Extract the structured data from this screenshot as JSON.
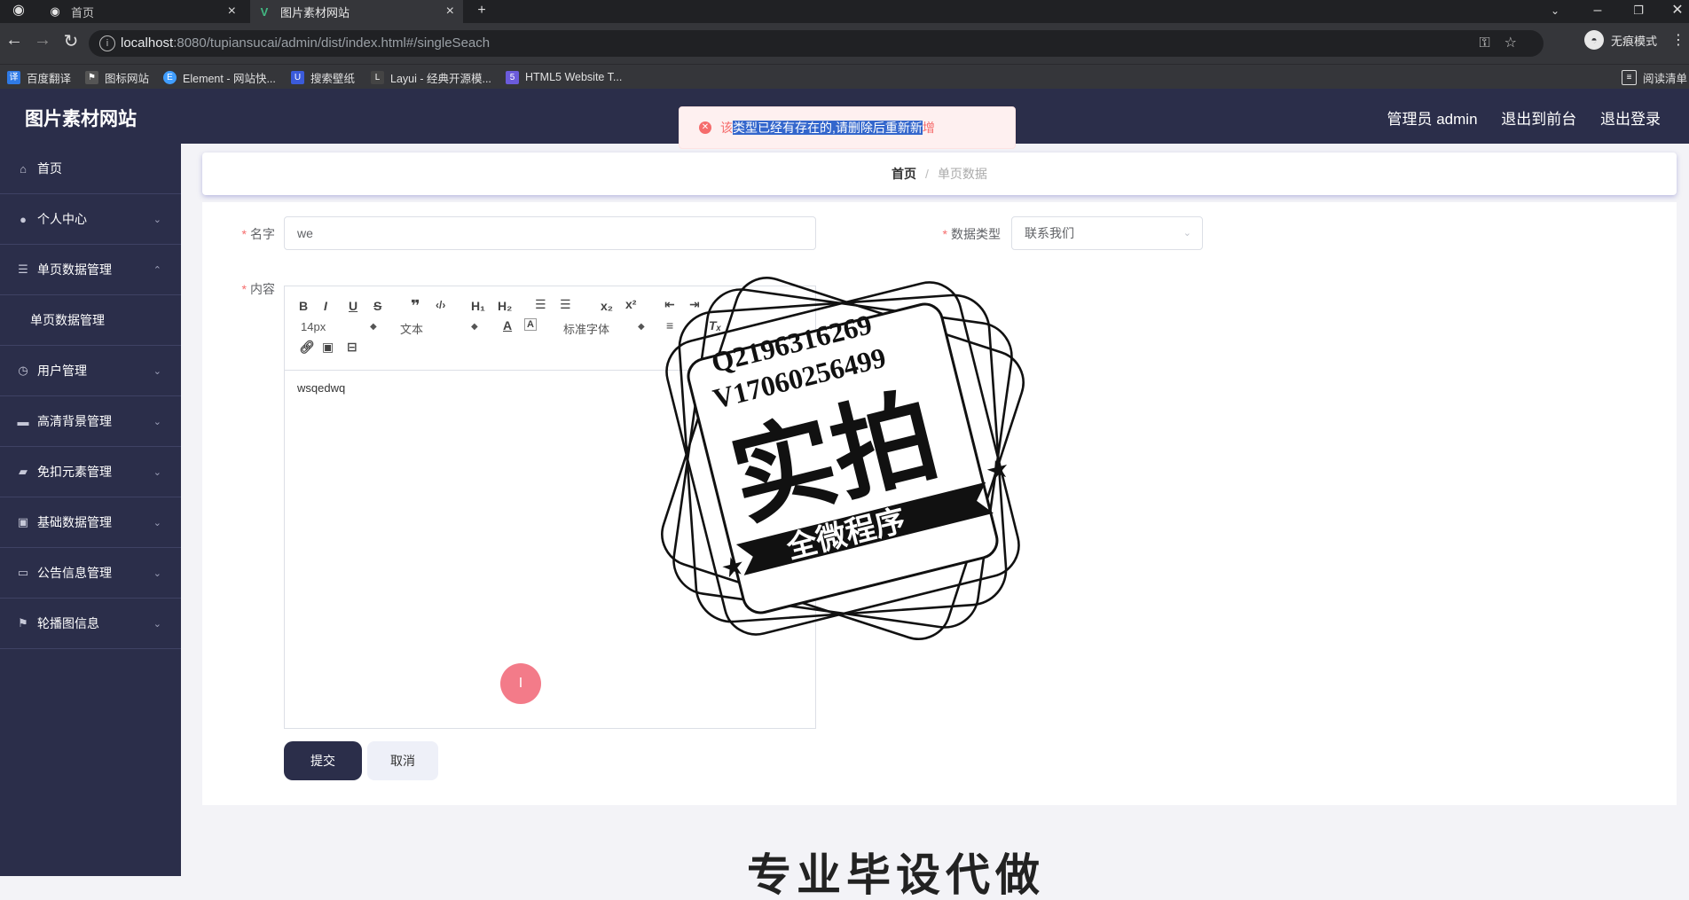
{
  "browser": {
    "tabs": [
      {
        "label": "首页"
      },
      {
        "label": "图片素材网站"
      }
    ],
    "url_host": "localhost",
    "url_rest": ":8080/tupiansucai/admin/dist/index.html#/singleSeach",
    "incognito_label": "无痕模式",
    "bookmarks": [
      "百度翻译",
      "图标网站",
      "Element - 网站快...",
      "搜索壁纸",
      "Layui - 经典开源模...",
      "HTML5 Website T..."
    ],
    "reading_list": "阅读清单"
  },
  "header": {
    "site_title": "图片素材网站",
    "admin_label": "管理员 admin",
    "back_front": "退出到前台",
    "logout": "退出登录"
  },
  "toast": {
    "message_pre": "该",
    "message_highlight": "类型已经有存在的,请删除后重新新",
    "message_post": "增"
  },
  "sidebar": {
    "items": [
      {
        "label": "首页",
        "icon": "home-icon"
      },
      {
        "label": "个人中心",
        "icon": "user-icon"
      },
      {
        "label": "单页数据管理",
        "icon": "list-icon"
      },
      {
        "label": "单页数据管理"
      },
      {
        "label": "用户管理",
        "icon": "clock-icon"
      },
      {
        "label": "高清背景管理",
        "icon": "monitor-icon"
      },
      {
        "label": "免扣元素管理",
        "icon": "ticket-icon"
      },
      {
        "label": "基础数据管理",
        "icon": "clipboard-icon"
      },
      {
        "label": "公告信息管理",
        "icon": "message-icon"
      },
      {
        "label": "轮播图信息",
        "icon": "flag-icon"
      }
    ]
  },
  "breadcrumb": {
    "home": "首页",
    "sep": "/",
    "current": "单页数据"
  },
  "form": {
    "name_label": "名字",
    "name_value": "we",
    "type_label": "数据类型",
    "type_value": "联系我们",
    "content_label": "内容",
    "content_value": "wsqedwq",
    "font_size": "14px",
    "block_format": "文本",
    "font_family": "标准字体",
    "submit": "提交",
    "cancel": "取消"
  },
  "watermark": {
    "line1": "Q2196316269",
    "line2": "V17060256499",
    "main": "实拍",
    "ribbon": "全微程序"
  },
  "bottom_text": "专业毕设代做"
}
